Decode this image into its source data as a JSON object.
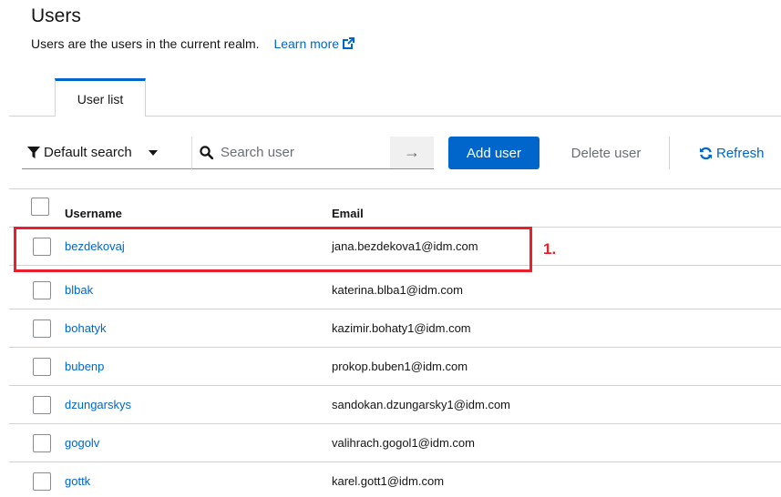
{
  "page": {
    "title": "Users",
    "description": "Users are the users in the current realm.",
    "learn_more": "Learn more"
  },
  "tabs": [
    {
      "label": "User list",
      "active": true
    }
  ],
  "toolbar": {
    "filter_label": "Default search",
    "search_placeholder": "Search user",
    "add_label": "Add user",
    "delete_label": "Delete user",
    "refresh_label": "Refresh"
  },
  "table": {
    "columns": [
      "Username",
      "Email"
    ],
    "rows": [
      {
        "username": "bezdekovaj",
        "email": "jana.bezdekova1@idm.com"
      },
      {
        "username": "blbak",
        "email": "katerina.blba1@idm.com"
      },
      {
        "username": "bohatyk",
        "email": "kazimir.bohaty1@idm.com"
      },
      {
        "username": "bubenp",
        "email": "prokop.buben1@idm.com"
      },
      {
        "username": "dzungarskys",
        "email": "sandokan.dzungarsky1@idm.com"
      },
      {
        "username": "gogolv",
        "email": "valihrach.gogol1@idm.com"
      },
      {
        "username": "gottk",
        "email": "karel.gott1@idm.com"
      }
    ]
  },
  "annotation": {
    "marker": "1.",
    "color": "#e8202d"
  },
  "colors": {
    "accent": "#0066cc",
    "text": "#151515",
    "muted": "#6a6e73",
    "border": "#d2d2d2"
  }
}
